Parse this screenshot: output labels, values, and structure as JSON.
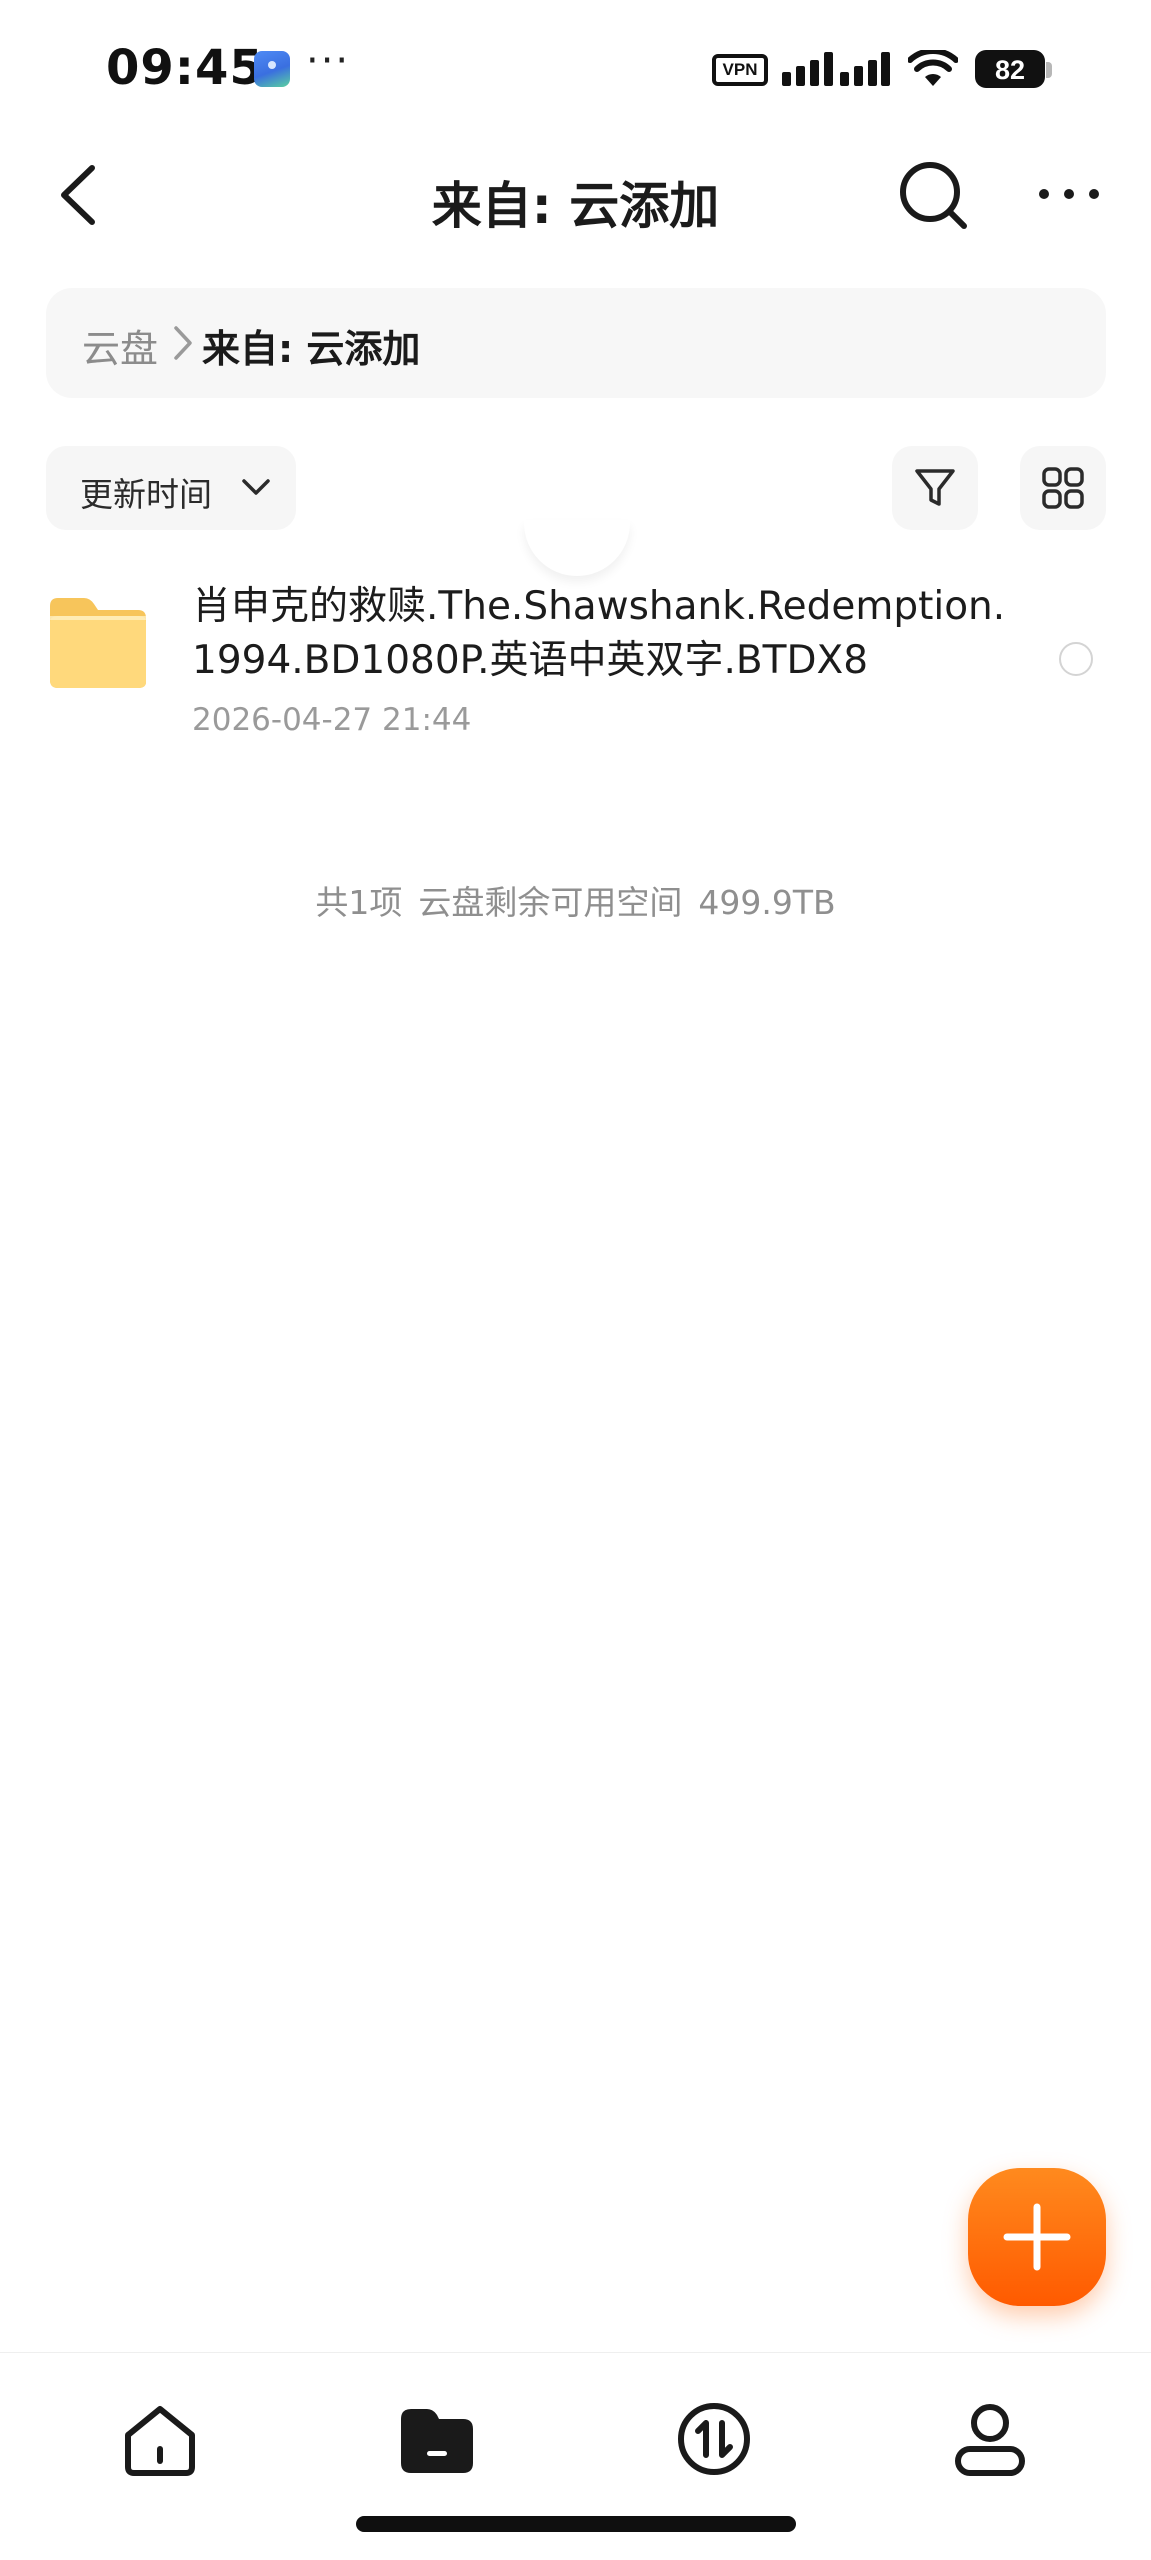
{
  "status_bar": {
    "time": "09:45",
    "dots": "···",
    "vpn_label": "VPN",
    "battery_level": "82",
    "icons": [
      "app-notification-icon",
      "signal-icon",
      "wifi-icon",
      "battery-icon"
    ]
  },
  "header": {
    "title": "来自: 云添加",
    "icons": [
      "back-icon",
      "search-icon",
      "more-icon"
    ]
  },
  "breadcrumb": {
    "root": "云盘",
    "current": "来自: 云添加"
  },
  "toolbar": {
    "sort_label": "更新时间",
    "icons": [
      "chevron-down-icon",
      "filter-icon",
      "grid-view-icon"
    ]
  },
  "files": [
    {
      "name": "肖申克的救赎.The.Shawshank.Redemption.1994.BD1080P.英语中英双字.BTDX8",
      "date": "2026-04-27 21:44",
      "icon": "folder-icon"
    }
  ],
  "summary": {
    "count": "共1项",
    "space_label": "云盘剩余可用空间",
    "space_value": "499.9TB"
  },
  "fab": {
    "icon": "plus-icon"
  },
  "bottom_nav": {
    "items": [
      {
        "icon": "home-icon"
      },
      {
        "icon": "folder-icon",
        "selected": true
      },
      {
        "icon": "transfer-icon"
      },
      {
        "icon": "profile-icon"
      }
    ]
  },
  "colors": {
    "accent": "#ff6a00",
    "folder": "#ffd675",
    "muted_text": "#9a9a9a"
  }
}
